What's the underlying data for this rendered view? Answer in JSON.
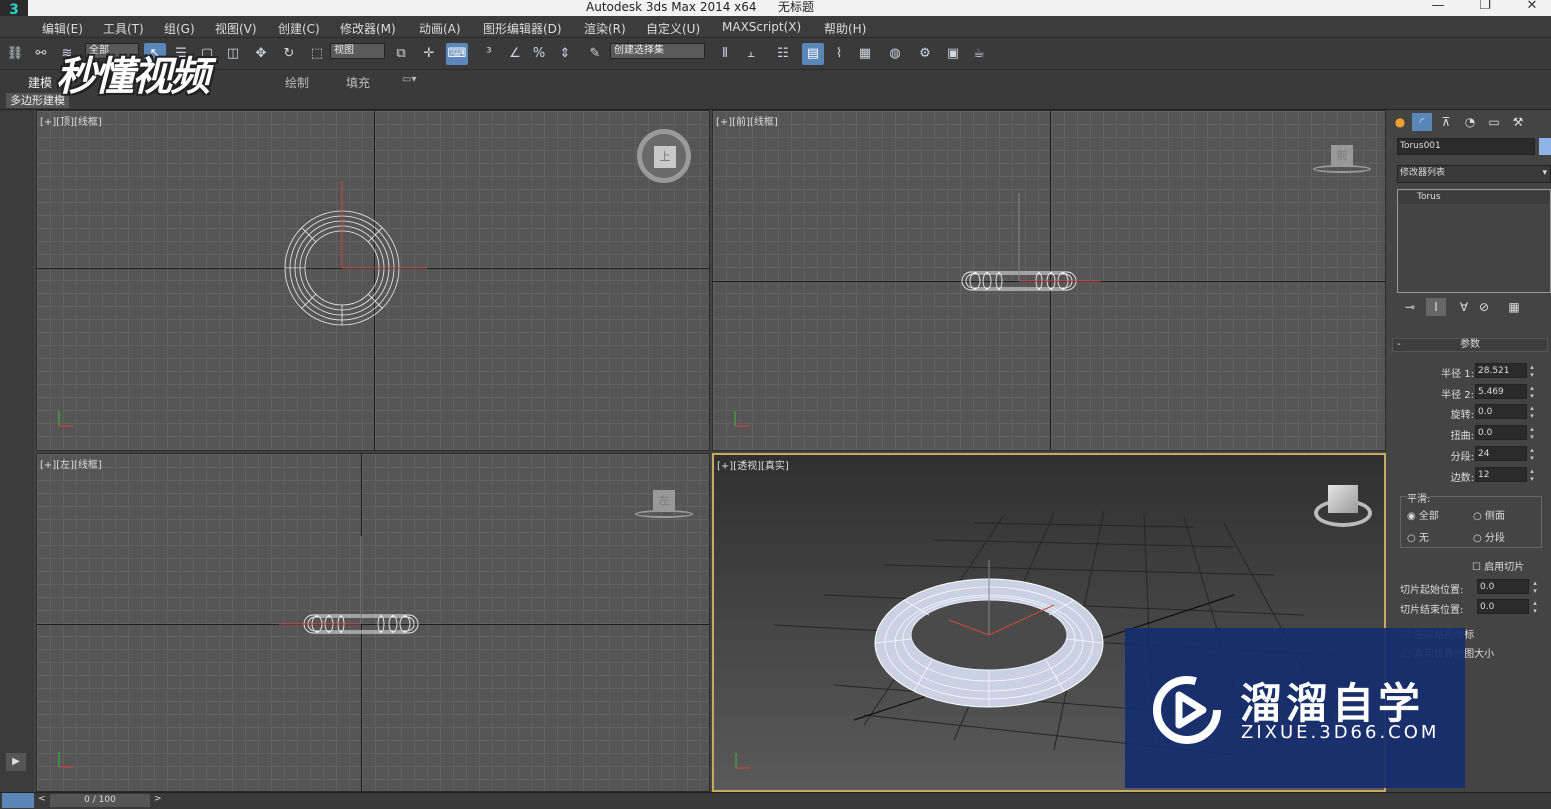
{
  "window": {
    "title": "Autodesk 3ds Max  2014 x64",
    "doc_name": "无标题",
    "minimize": "—",
    "maximize": "❐",
    "close": "✕"
  },
  "menu": [
    "编辑(E)",
    "工具(T)",
    "组(G)",
    "视图(V)",
    "创建(C)",
    "修改器(M)",
    "动画(A)",
    "图形编辑器(D)",
    "渲染(R)",
    "自定义(U)",
    "MAXScript(X)",
    "帮助(H)"
  ],
  "toolbar": {
    "selection_filter": "全部",
    "reference_coord": "视图",
    "named_selection": "创建选择集"
  },
  "ribbon": {
    "tabs": [
      "建模",
      "绘制",
      "填充"
    ],
    "sub_label": "多边形建模"
  },
  "watermark": {
    "text": "秒懂视频"
  },
  "viewports": {
    "top": {
      "label": "[+][顶][线框]",
      "cube_label": "上"
    },
    "front": {
      "label": "[+][前][线框]",
      "cube_label": "前"
    },
    "left": {
      "label": "[+][左][线框]",
      "cube_label": "左"
    },
    "perspective": {
      "label": "[+][透视][真实]"
    }
  },
  "command_panel": {
    "object_name": "Torus001",
    "modifier_list": "修改器列表",
    "stack": [
      "Torus"
    ],
    "rollout_title": "参数",
    "params": [
      {
        "label": "半径 1:",
        "value": "28.521"
      },
      {
        "label": "半径 2:",
        "value": "5.469"
      },
      {
        "label": "旋转:",
        "value": "0.0"
      },
      {
        "label": "扭曲:",
        "value": "0.0"
      },
      {
        "label": "分段:",
        "value": "24"
      },
      {
        "label": "边数:",
        "value": "12"
      }
    ],
    "smooth": {
      "title": "平滑:",
      "all": "全部",
      "sides": "侧面",
      "none": "无",
      "segments": "分段"
    },
    "slice_on": "启用切片",
    "slice_from": {
      "label": "切片起始位置:",
      "value": "0.0"
    },
    "slice_to": {
      "label": "切片结束位置:",
      "value": "0.0"
    },
    "gen_map": "生成贴图坐标",
    "real_world": "真实世界贴图大小"
  },
  "timeline": {
    "frame": "0 / 100"
  },
  "zixue": {
    "title": "溜溜自学",
    "url": "ZIXUE.3D66.COM"
  },
  "colors": {
    "viewport_bg": "#555555",
    "active_border": "#c8aa5c",
    "accent": "#5b86b8"
  }
}
